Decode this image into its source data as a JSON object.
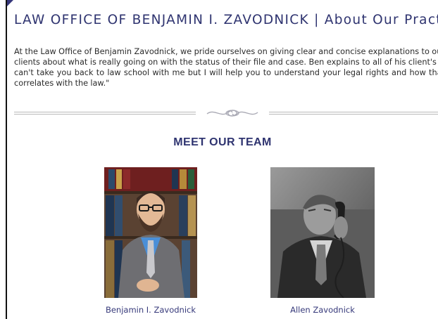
{
  "header": {
    "title": "LAW OFFICE OF BENJAMIN I. ZAVODNICK | About Our Practice"
  },
  "intro": {
    "text": "At the Law Office of Benjamin Zavodnick, we pride ourselves on giving clear and concise explanations to our clients about what is really going on with the status of their file and case. Ben explains to all of his client's \"I can't take you back to law school with me but I will help you to understand your legal rights and how that correlates with the law.\""
  },
  "team": {
    "heading": "MEET OUR TEAM",
    "members": [
      {
        "name": "Benjamin I. Zavodnick"
      },
      {
        "name": "Allen Zavodnick"
      }
    ]
  },
  "colors": {
    "accent": "#2f3470",
    "text": "#2b2b2b",
    "divider": "#b8b8b8"
  }
}
